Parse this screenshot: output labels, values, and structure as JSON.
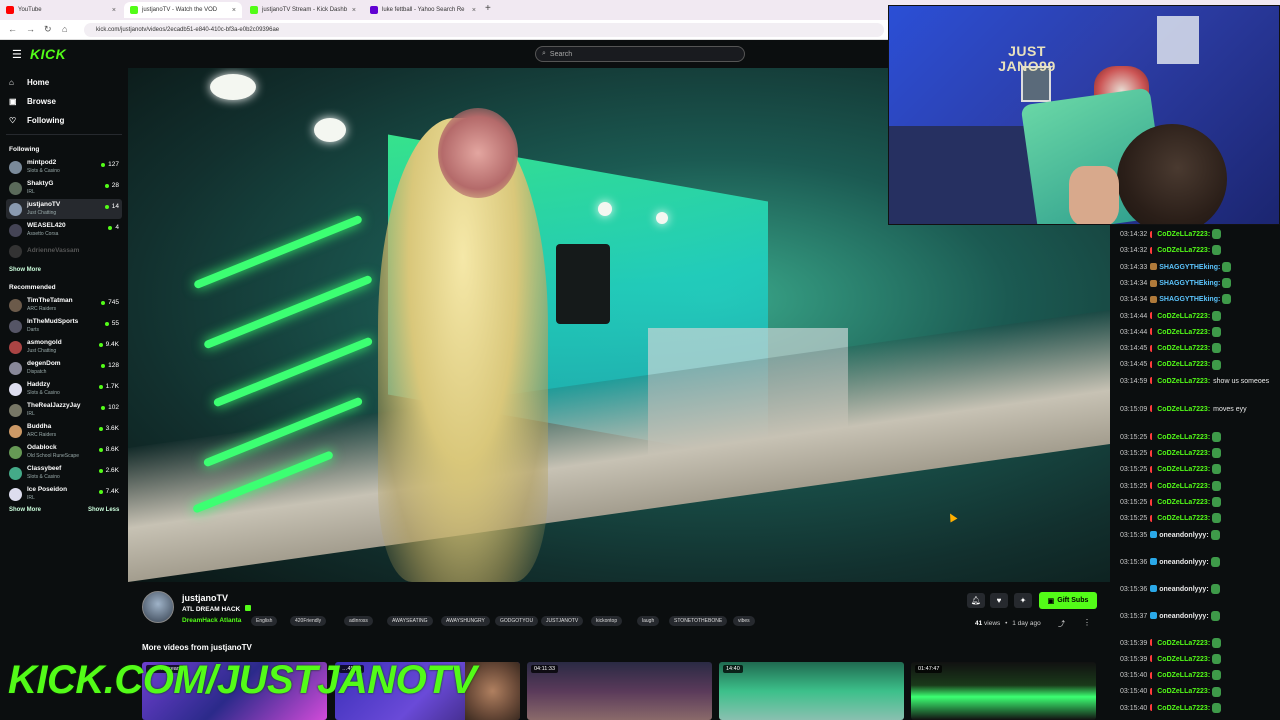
{
  "browser": {
    "tabs": [
      {
        "title": "YouTube",
        "color": "#ff0000"
      },
      {
        "title": "justjanoTV - Watch the VOD",
        "color": "#53fc18"
      },
      {
        "title": "justjanoTV Stream - Kick Dashb",
        "color": "#53fc18"
      },
      {
        "title": "luke fettball - Yahoo Search Re",
        "color": "#6001d2"
      }
    ],
    "url": "kick.com/justjanotv/videos/2ecadb51-e840-410c-bf3a-e0b2c09396ae"
  },
  "header": {
    "logo": "KICK",
    "search_placeholder": "Search"
  },
  "sidebar": {
    "nav": [
      {
        "label": "Home",
        "icon": "home-icon"
      },
      {
        "label": "Browse",
        "icon": "browse-icon"
      },
      {
        "label": "Following",
        "icon": "heart-icon"
      }
    ],
    "following_title": "Following",
    "following": [
      {
        "name": "mintpod2",
        "category": "Slots & Casino",
        "viewers": "127"
      },
      {
        "name": "ShaktyG",
        "category": "IRL",
        "viewers": "28"
      },
      {
        "name": "justjanoTV",
        "category": "Just Chatting",
        "viewers": "14"
      },
      {
        "name": "WEASEL420",
        "category": "Assetto Corsa",
        "viewers": "4"
      },
      {
        "name": "AdrienneVassam",
        "category": "",
        "viewers": ""
      }
    ],
    "show_more_1": "Show More",
    "recommended_title": "Recommended",
    "recommended": [
      {
        "name": "TimTheTatman",
        "category": "ARC Raiders",
        "viewers": "745"
      },
      {
        "name": "InTheMudSports",
        "category": "Darts",
        "viewers": "55"
      },
      {
        "name": "asmongold",
        "category": "Just Chatting",
        "viewers": "9.4K"
      },
      {
        "name": "degenDom",
        "category": "Dispatch",
        "viewers": "128"
      },
      {
        "name": "Haddzy",
        "category": "Slots & Casino",
        "viewers": "1.7K"
      },
      {
        "name": "TheRealJazzyJay",
        "category": "IRL",
        "viewers": "102"
      },
      {
        "name": "Buddha",
        "category": "ARC Raiders",
        "viewers": "3.6K"
      },
      {
        "name": "Odablock",
        "category": "Old School RuneScape",
        "viewers": "8.6K"
      },
      {
        "name": "Classybeef",
        "category": "Slots & Casino",
        "viewers": "2.6K"
      },
      {
        "name": "Ice Poseidon",
        "category": "IRL",
        "viewers": "7.4K"
      }
    ],
    "show_more_2": "Show More",
    "show_less": "Show Less"
  },
  "webcam": {
    "sign_text": "JUST JANO99"
  },
  "chat": [
    {
      "time": "03:14:32",
      "user": "CoDZeLLa7223:",
      "color": "#53fc18",
      "text": "",
      "emote": true
    },
    {
      "time": "03:14:32",
      "user": "CoDZeLLa7223:",
      "color": "#53fc18",
      "text": "",
      "emote": true
    },
    {
      "time": "03:14:33",
      "user": "SHAGGYTHEking:",
      "color": "#5cc6ff",
      "text": "",
      "emote": true
    },
    {
      "time": "03:14:34",
      "user": "SHAGGYTHEking:",
      "color": "#5cc6ff",
      "text": "",
      "emote": true
    },
    {
      "time": "03:14:34",
      "user": "SHAGGYTHEking:",
      "color": "#5cc6ff",
      "text": "",
      "emote": true
    },
    {
      "time": "03:14:44",
      "user": "CoDZeLLa7223:",
      "color": "#53fc18",
      "text": "",
      "emote": true
    },
    {
      "time": "03:14:44",
      "user": "CoDZeLLa7223:",
      "color": "#53fc18",
      "text": "",
      "emote": true
    },
    {
      "time": "03:14:45",
      "user": "CoDZeLLa7223:",
      "color": "#53fc18",
      "text": "",
      "emote": true
    },
    {
      "time": "03:14:45",
      "user": "CoDZeLLa7223:",
      "color": "#53fc18",
      "text": "",
      "emote": true
    },
    {
      "time": "03:14:59",
      "user": "CoDZeLLa7223:",
      "color": "#53fc18",
      "text": "show us someoes",
      "emote": false
    },
    {
      "time": "03:15:09",
      "user": "CoDZeLLa7223:",
      "color": "#53fc18",
      "text": "moves eyy",
      "emote": false
    },
    {
      "time": "03:15:25",
      "user": "CoDZeLLa7223:",
      "color": "#53fc18",
      "text": "",
      "emote": true
    },
    {
      "time": "03:15:25",
      "user": "CoDZeLLa7223:",
      "color": "#53fc18",
      "text": "",
      "emote": true
    },
    {
      "time": "03:15:25",
      "user": "CoDZeLLa7223:",
      "color": "#53fc18",
      "text": "",
      "emote": true
    },
    {
      "time": "03:15:25",
      "user": "CoDZeLLa7223:",
      "color": "#53fc18",
      "text": "",
      "emote": true
    },
    {
      "time": "03:15:25",
      "user": "CoDZeLLa7223:",
      "color": "#53fc18",
      "text": "",
      "emote": true
    },
    {
      "time": "03:15:25",
      "user": "CoDZeLLa7223:",
      "color": "#53fc18",
      "text": "",
      "emote": true
    },
    {
      "time": "03:15:35",
      "user": "oneandonlyyy:",
      "color": "#e8e8e8",
      "text": "",
      "emote": true
    },
    {
      "time": "03:15:36",
      "user": "oneandonlyyy:",
      "color": "#e8e8e8",
      "text": "",
      "emote": true
    },
    {
      "time": "03:15:36",
      "user": "oneandonlyyy:",
      "color": "#e8e8e8",
      "text": "",
      "emote": true
    },
    {
      "time": "03:15:37",
      "user": "oneandonlyyy:",
      "color": "#e8e8e8",
      "text": "",
      "emote": true
    },
    {
      "time": "03:15:39",
      "user": "CoDZeLLa7223:",
      "color": "#53fc18",
      "text": "",
      "emote": true
    },
    {
      "time": "03:15:39",
      "user": "CoDZeLLa7223:",
      "color": "#53fc18",
      "text": "",
      "emote": true
    },
    {
      "time": "03:15:40",
      "user": "CoDZeLLa7223:",
      "color": "#53fc18",
      "text": "",
      "emote": true
    },
    {
      "time": "03:15:40",
      "user": "CoDZeLLa7223:",
      "color": "#53fc18",
      "text": "",
      "emote": true
    },
    {
      "time": "03:15:40",
      "user": "CoDZeLLa7223:",
      "color": "#53fc18",
      "text": "",
      "emote": true
    }
  ],
  "stream": {
    "channel": "justjanoTV",
    "title": "ATL DREAM HACK",
    "category": "DreamHack Atlanta",
    "tags": [
      "English",
      "420Friendly",
      "adinross",
      "AWAYSEATING",
      "AWAYSHUNGRY",
      "GODGOTYOU",
      "JUSTJANOTV",
      "kickontop",
      "laugh",
      "STONETOTHEBONE",
      "vibes"
    ],
    "views_count": "41",
    "views_label": "views",
    "age": "1 day ago",
    "gift_label": "Gift Subs"
  },
  "more_videos": {
    "title": "More videos from justjanoTV",
    "thumbs": [
      {
        "duration": "",
        "label": "…ent Stream"
      },
      {
        "duration": "…45:59",
        "label": ""
      },
      {
        "duration": "04:11:33",
        "label": ""
      },
      {
        "duration": "14:40",
        "label": ""
      },
      {
        "duration": "01:47:47",
        "label": ""
      }
    ]
  },
  "overlay_text": "KICK.COM/JUSTJANOTV",
  "colors": {
    "accent": "#53fc18",
    "bg": "#0b0e0f"
  }
}
